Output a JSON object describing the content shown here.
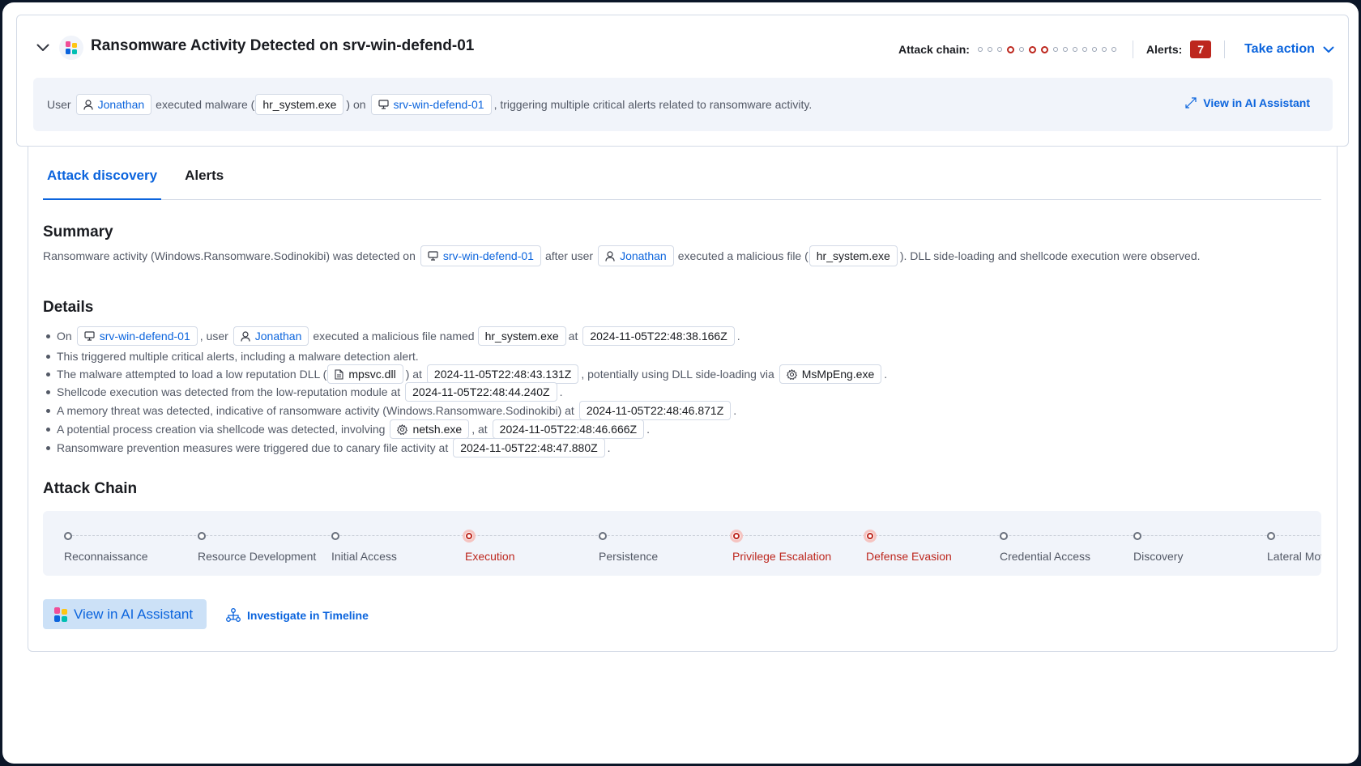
{
  "header": {
    "title": "Ransomware Activity Detected on srv-win-defend-01",
    "attack_chain_label": "Attack chain:",
    "attack_chain_dots": [
      false,
      false,
      false,
      true,
      false,
      true,
      true,
      false,
      false,
      false,
      false,
      false,
      false,
      false
    ],
    "alerts_label": "Alerts:",
    "alerts_count": "7",
    "take_action_label": "Take action",
    "colors": {
      "accent": "#0b64dd",
      "danger": "#bd271e"
    }
  },
  "overview": {
    "t1": "User",
    "user": "Jonathan",
    "t2": "executed malware (",
    "file": "hr_system.exe",
    "t3": ") on",
    "host": "srv-win-defend-01",
    "t4": ", triggering multiple critical alerts related to ransomware activity.",
    "ai_link": "View in AI Assistant"
  },
  "tabs": [
    {
      "label": "Attack discovery",
      "active": true
    },
    {
      "label": "Alerts",
      "active": false
    }
  ],
  "summary": {
    "heading": "Summary",
    "t1": "Ransomware activity (Windows.Ransomware.Sodinokibi) was detected on",
    "host": "srv-win-defend-01",
    "t2": "after user",
    "user": "Jonathan",
    "t3": "executed a malicious file (",
    "file": "hr_system.exe",
    "t4": "). DLL side-loading and shellcode execution were observed."
  },
  "details": {
    "heading": "Details",
    "items": [
      {
        "t1": "On",
        "host": "srv-win-defend-01",
        "t2": ", user",
        "user": "Jonathan",
        "t3": "executed a malicious file named",
        "file": "hr_system.exe",
        "t4": "at",
        "ts": "2024-11-05T22:48:38.166Z",
        "t5": "."
      },
      {
        "t1": "This triggered multiple critical alerts, including a malware detection alert."
      },
      {
        "t1": "The malware attempted to load a low reputation DLL (",
        "file": "mpsvc.dll",
        "t2": ") at",
        "ts": "2024-11-05T22:48:43.131Z",
        "t3": ", potentially using DLL side-loading via",
        "process": "MsMpEng.exe",
        "t4": "."
      },
      {
        "t1": "Shellcode execution was detected from the low-reputation module at",
        "ts": "2024-11-05T22:48:44.240Z",
        "t2": "."
      },
      {
        "t1": "A memory threat was detected, indicative of ransomware activity (Windows.Ransomware.Sodinokibi) at",
        "ts": "2024-11-05T22:48:46.871Z",
        "t2": "."
      },
      {
        "t1": "A potential process creation via shellcode was detected, involving",
        "process": "netsh.exe",
        "t2": ", at",
        "ts": "2024-11-05T22:48:46.666Z",
        "t3": "."
      },
      {
        "t1": "Ransomware prevention measures were triggered due to canary file activity at",
        "ts": "2024-11-05T22:48:47.880Z",
        "t2": "."
      }
    ]
  },
  "attack_chain": {
    "heading": "Attack Chain",
    "stages": [
      {
        "label": "Reconnaissance",
        "detected": false
      },
      {
        "label": "Resource Development",
        "detected": false
      },
      {
        "label": "Initial Access",
        "detected": false
      },
      {
        "label": "Execution",
        "detected": true
      },
      {
        "label": "Persistence",
        "detected": false
      },
      {
        "label": "Privilege Escalation",
        "detected": true
      },
      {
        "label": "Defense Evasion",
        "detected": true
      },
      {
        "label": "Credential Access",
        "detected": false
      },
      {
        "label": "Discovery",
        "detected": false
      },
      {
        "label": "Lateral Movement",
        "detected": false
      }
    ]
  },
  "actions": {
    "ai_button": "View in AI Assistant",
    "timeline_link": "Investigate in Timeline"
  }
}
